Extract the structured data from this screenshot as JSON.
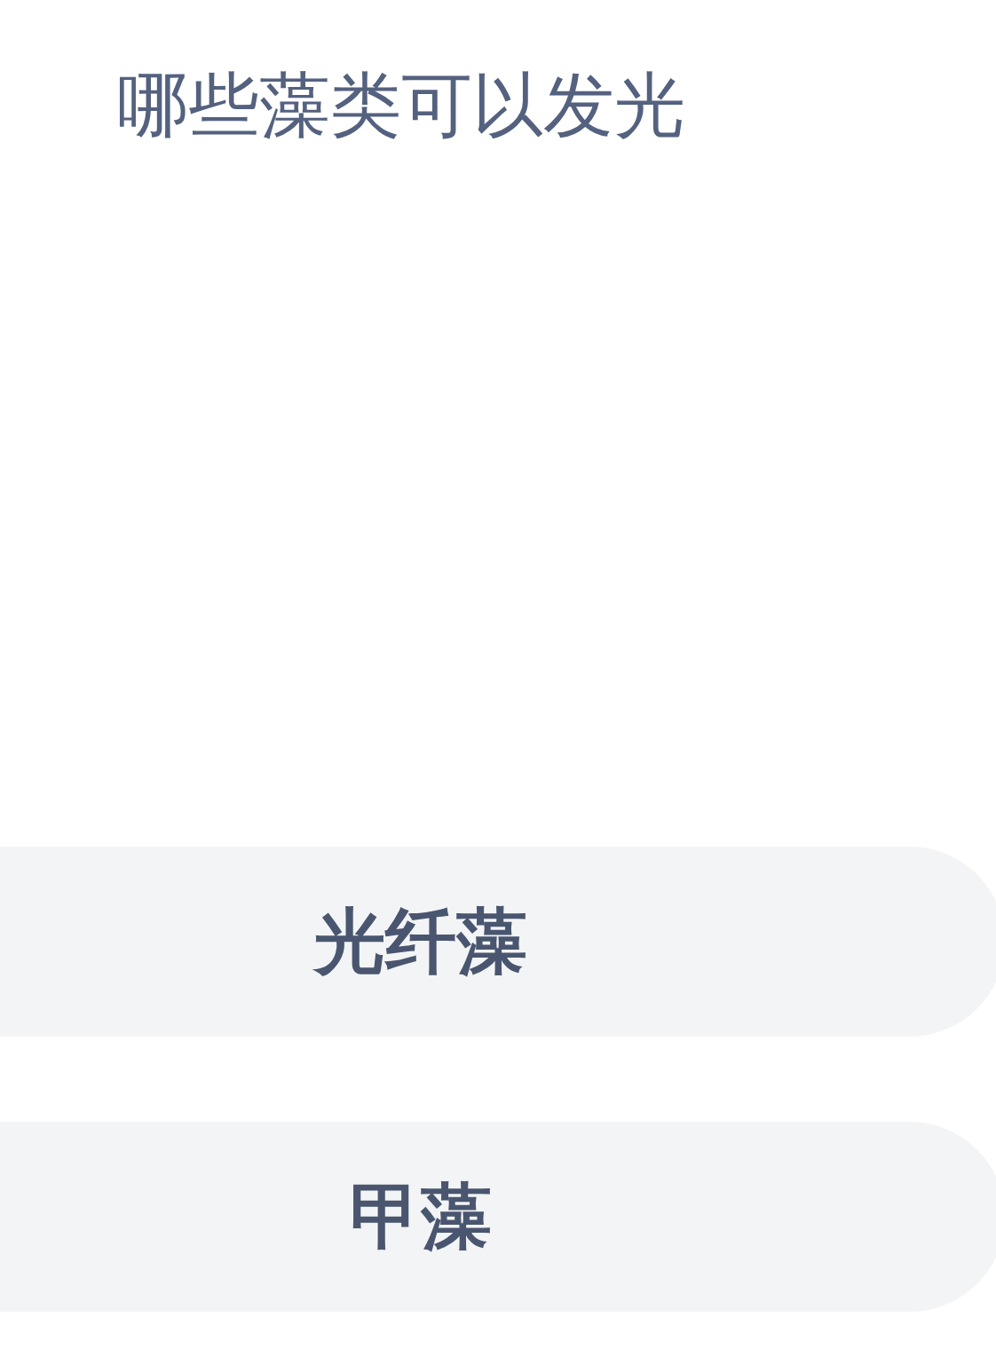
{
  "question": "哪些藻类可以发光",
  "options": [
    {
      "label": "光纤藻"
    },
    {
      "label": "甲藻"
    }
  ]
}
